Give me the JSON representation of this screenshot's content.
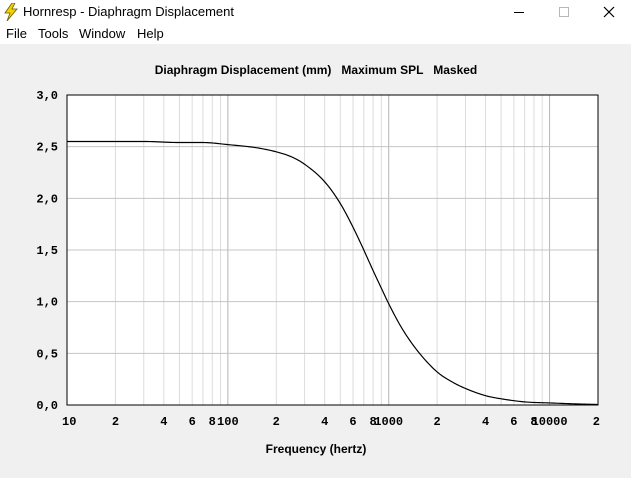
{
  "window": {
    "title": "Hornresp - Diaphragm Displacement",
    "icon": "lightning-bolt-icon",
    "controls": [
      "minimize-icon",
      "maximize-icon",
      "close-icon"
    ]
  },
  "menu": {
    "items": [
      "File",
      "Tools",
      "Window",
      "Help"
    ]
  },
  "chart_data": {
    "type": "line",
    "title": "Diaphragm Displacement (mm)   Maximum SPL   Masked",
    "xlabel": "Frequency (hertz)",
    "ylabel": "",
    "x_scale": "log",
    "xlim": [
      10,
      20000
    ],
    "ylim": [
      0,
      3
    ],
    "x_ticks": [
      {
        "value": 10,
        "label": "10"
      },
      {
        "value": 20,
        "label": "2"
      },
      {
        "value": 40,
        "label": "4"
      },
      {
        "value": 60,
        "label": "6"
      },
      {
        "value": 80,
        "label": "8"
      },
      {
        "value": 100,
        "label": "100"
      },
      {
        "value": 200,
        "label": "2"
      },
      {
        "value": 400,
        "label": "4"
      },
      {
        "value": 600,
        "label": "6"
      },
      {
        "value": 800,
        "label": "8"
      },
      {
        "value": 1000,
        "label": "1000"
      },
      {
        "value": 2000,
        "label": "2"
      },
      {
        "value": 4000,
        "label": "4"
      },
      {
        "value": 6000,
        "label": "6"
      },
      {
        "value": 8000,
        "label": "8"
      },
      {
        "value": 10000,
        "label": "10000"
      },
      {
        "value": 20000,
        "label": "2"
      }
    ],
    "y_ticks": [
      {
        "value": 0,
        "label": "0,0"
      },
      {
        "value": 0.5,
        "label": "0,5"
      },
      {
        "value": 1.0,
        "label": "1,0"
      },
      {
        "value": 1.5,
        "label": "1,5"
      },
      {
        "value": 2.0,
        "label": "2,0"
      },
      {
        "value": 2.5,
        "label": "2,5"
      },
      {
        "value": 3.0,
        "label": "3,0"
      }
    ],
    "grid": true,
    "line_color": "#000000",
    "series": [
      {
        "x": [
          10,
          20,
          30,
          50,
          70,
          100,
          150,
          200,
          250,
          300,
          400,
          500,
          600,
          700,
          800,
          900,
          1000,
          1200,
          1500,
          2000,
          2500,
          3000,
          4000,
          5000,
          7000,
          10000,
          15000,
          20000
        ],
        "y": [
          2.55,
          2.55,
          2.55,
          2.54,
          2.54,
          2.52,
          2.49,
          2.45,
          2.4,
          2.33,
          2.16,
          1.95,
          1.72,
          1.5,
          1.3,
          1.13,
          0.98,
          0.75,
          0.53,
          0.32,
          0.22,
          0.16,
          0.09,
          0.06,
          0.03,
          0.02,
          0.01,
          0.005
        ]
      }
    ]
  }
}
